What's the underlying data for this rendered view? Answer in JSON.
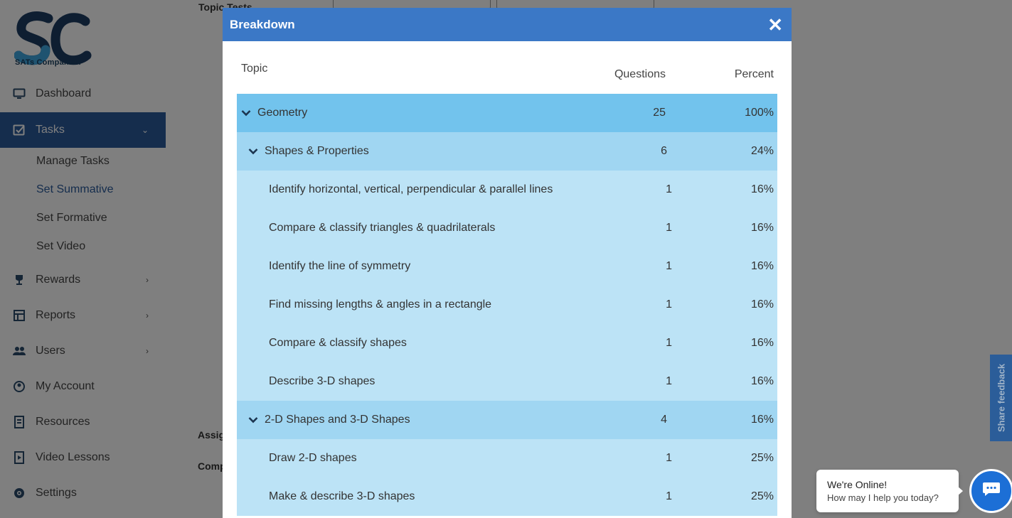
{
  "app": {
    "logo_text": "SATs Companion"
  },
  "sidebar": {
    "items": [
      {
        "label": "Dashboard",
        "icon": "monitor-icon"
      },
      {
        "label": "Tasks",
        "icon": "tasks-icon"
      },
      {
        "label": "Rewards",
        "icon": "trophy-icon"
      },
      {
        "label": "Reports",
        "icon": "reports-icon"
      },
      {
        "label": "Users",
        "icon": "users-icon"
      },
      {
        "label": "My Account",
        "icon": "account-icon"
      },
      {
        "label": "Resources",
        "icon": "resources-icon"
      },
      {
        "label": "Video Lessons",
        "icon": "video-icon"
      },
      {
        "label": "Settings",
        "icon": "gear-icon"
      }
    ],
    "tasks_subitems": [
      "Manage Tasks",
      "Set Summative",
      "Set Formative",
      "Set Video"
    ]
  },
  "background": {
    "topic_tests_label": "Topic Tests",
    "assign_label": "Assig",
    "comp_label": "Comp"
  },
  "modal": {
    "title": "Breakdown",
    "columns": {
      "topic": "Topic",
      "questions": "Questions",
      "percent": "Percent"
    },
    "rows": [
      {
        "level": 0,
        "name": "Geometry",
        "questions": "25",
        "percent": "100%",
        "expandable": true
      },
      {
        "level": 1,
        "name": "Shapes & Properties",
        "questions": "6",
        "percent": "24%",
        "expandable": true
      },
      {
        "level": 2,
        "name": "Identify horizontal, vertical, perpendicular & parallel lines",
        "questions": "1",
        "percent": "16%"
      },
      {
        "level": 2,
        "name": "Compare & classify triangles & quadrilaterals",
        "questions": "1",
        "percent": "16%"
      },
      {
        "level": 2,
        "name": "Identify the line of symmetry",
        "questions": "1",
        "percent": "16%"
      },
      {
        "level": 2,
        "name": "Find missing lengths & angles in a rectangle",
        "questions": "1",
        "percent": "16%"
      },
      {
        "level": 2,
        "name": "Compare & classify shapes",
        "questions": "1",
        "percent": "16%"
      },
      {
        "level": 2,
        "name": "Describe 3-D shapes",
        "questions": "1",
        "percent": "16%"
      },
      {
        "level": 1,
        "name": "2-D Shapes and 3-D Shapes",
        "questions": "4",
        "percent": "16%",
        "expandable": true
      },
      {
        "level": 2,
        "name": "Draw 2-D shapes",
        "questions": "1",
        "percent": "25%"
      },
      {
        "level": 2,
        "name": "Make & describe 3-D shapes",
        "questions": "1",
        "percent": "25%"
      }
    ]
  },
  "feedback": {
    "label": "Share feedback"
  },
  "chat": {
    "title": "We're Online!",
    "subtitle": "How may I help you today?"
  },
  "colors": {
    "header": "#3b78c6",
    "row_level0": "#72c3ed",
    "row_level1": "#a0d6f2",
    "row_level2": "#bce3f6",
    "sidebar_active": "#2a5a9a"
  }
}
